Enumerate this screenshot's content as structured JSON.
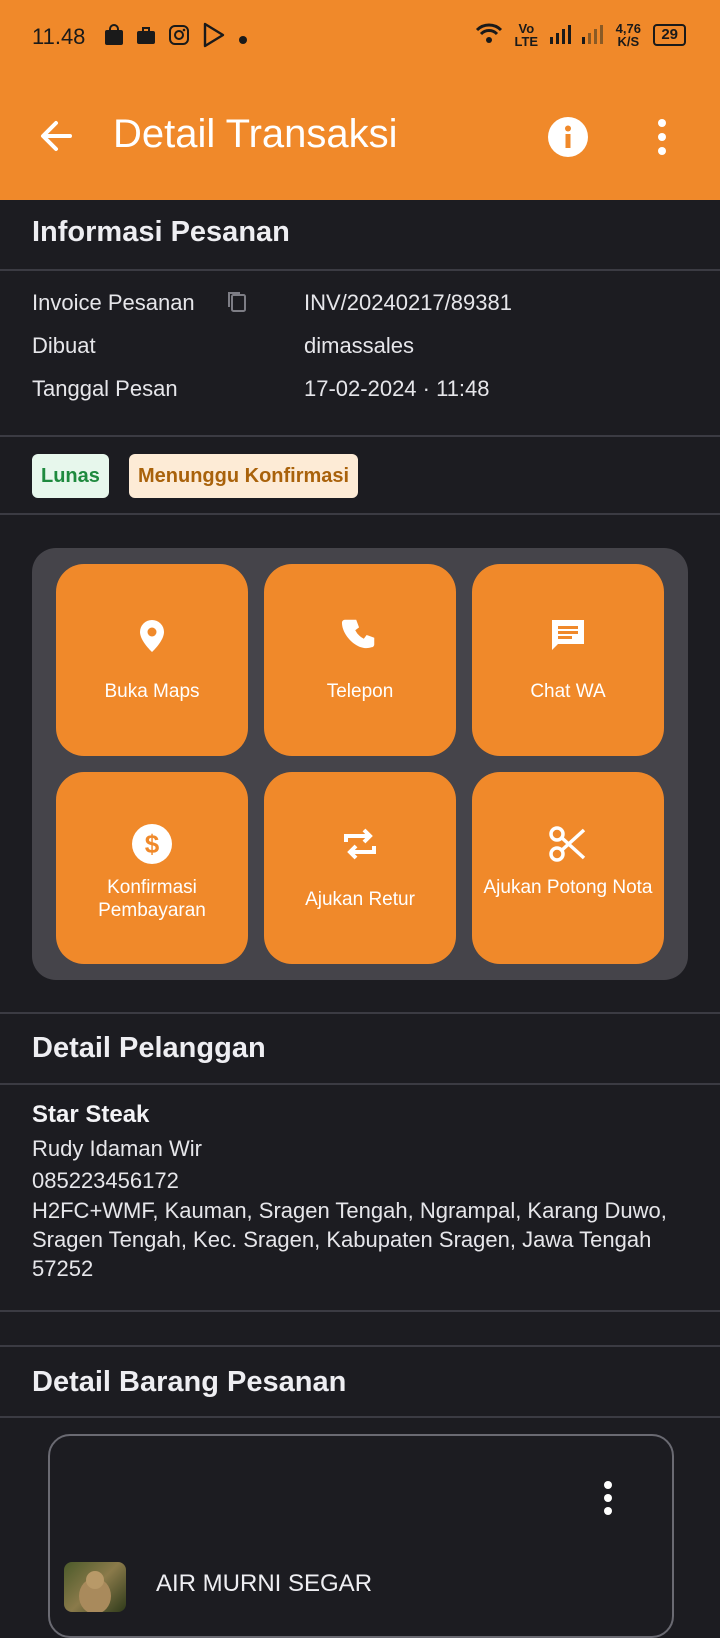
{
  "status_bar": {
    "time": "11.48",
    "network": "Vo LTE",
    "speed": "4,76 K/S",
    "battery": "29"
  },
  "app_bar": {
    "title": "Detail Transaksi",
    "back_icon": "arrow-left-icon",
    "info_icon": "info-icon",
    "more_icon": "more-vertical-icon",
    "color": "#f0892a"
  },
  "order_info": {
    "heading": "Informasi Pesanan",
    "rows": [
      {
        "label": "Invoice Pesanan",
        "value": "INV/20240217/89381"
      },
      {
        "label": "Dibuat",
        "value": "dimassales"
      },
      {
        "label": "Tanggal Pesan",
        "value": "17-02-2024 · 11:48"
      }
    ],
    "badges": [
      "Lunas",
      "Menunggu Konfirmasi"
    ]
  },
  "actions": [
    {
      "label": "Buka Maps",
      "icon": "map-pin-icon"
    },
    {
      "label": "Telepon",
      "icon": "phone-icon"
    },
    {
      "label": "Chat WA",
      "icon": "chat-icon"
    },
    {
      "label": "Konfirmasi Pembayaran",
      "icon": "dollar-icon"
    },
    {
      "label": "Ajukan Retur",
      "icon": "repeat-icon"
    },
    {
      "label": "Ajukan Potong Nota",
      "icon": "scissors-icon"
    }
  ],
  "customer": {
    "heading": "Detail Pelanggan",
    "name": "Star Steak",
    "contact": "Rudy Idaman Wir",
    "phone": "085223456172",
    "address": "H2FC+WMF, Kauman, Sragen Tengah, Ngrampal, Karang Duwo, Sragen Tengah, Kec. Sragen, Kabupaten Sragen, Jawa Tengah 57252"
  },
  "items": {
    "heading": "Detail Barang Pesanan",
    "list": [
      {
        "name": "AIR MURNI SEGAR"
      }
    ]
  }
}
